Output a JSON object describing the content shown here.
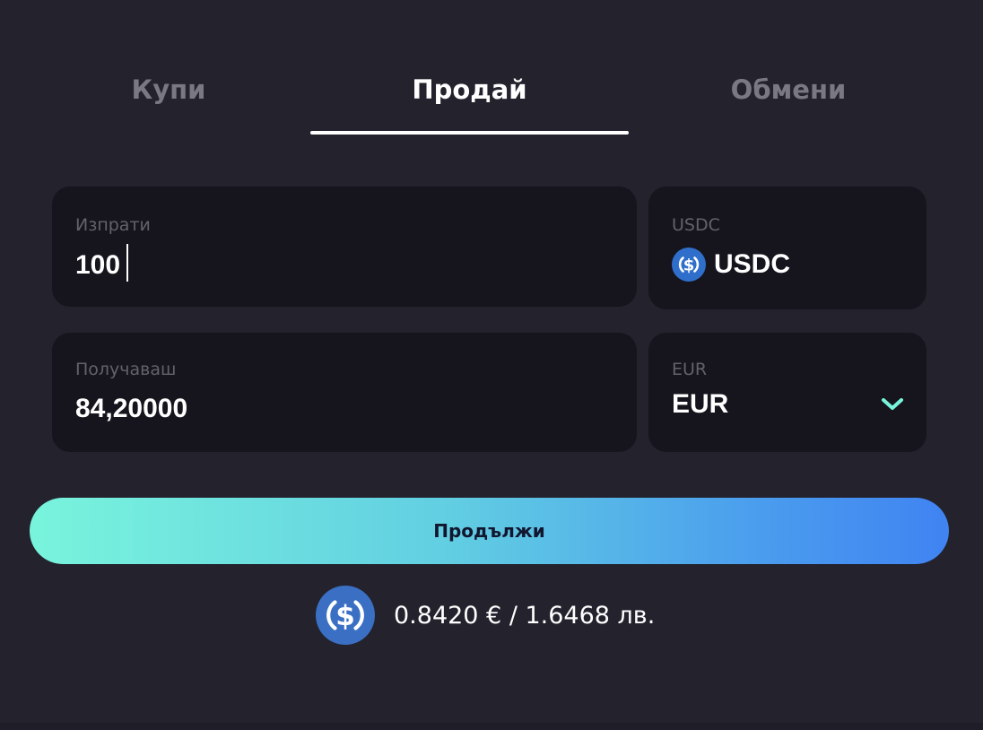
{
  "tabs": {
    "buy": "Купи",
    "sell": "Продай",
    "exchange": "Обмени",
    "active": "sell"
  },
  "send": {
    "label": "Изпрати",
    "value": "100"
  },
  "send_currency": {
    "label": "USDC",
    "value": "USDC",
    "icon": "usdc-coin-icon"
  },
  "receive": {
    "label": "Получаваш",
    "value": "84,20000"
  },
  "receive_currency": {
    "label": "EUR",
    "value": "EUR",
    "icon": "chevron-down-icon"
  },
  "continue_label": "Продължи",
  "rate": {
    "text": "0.8420 € / 1.6468 лв.",
    "icon": "usdc-coin-icon"
  },
  "colors": {
    "background": "#23222d",
    "card": "#16151d",
    "accent": "#79f4dc",
    "usdc_blue": "#2775ca",
    "button_gradient_start": "#79f4dc",
    "button_gradient_end": "#4083f2"
  }
}
